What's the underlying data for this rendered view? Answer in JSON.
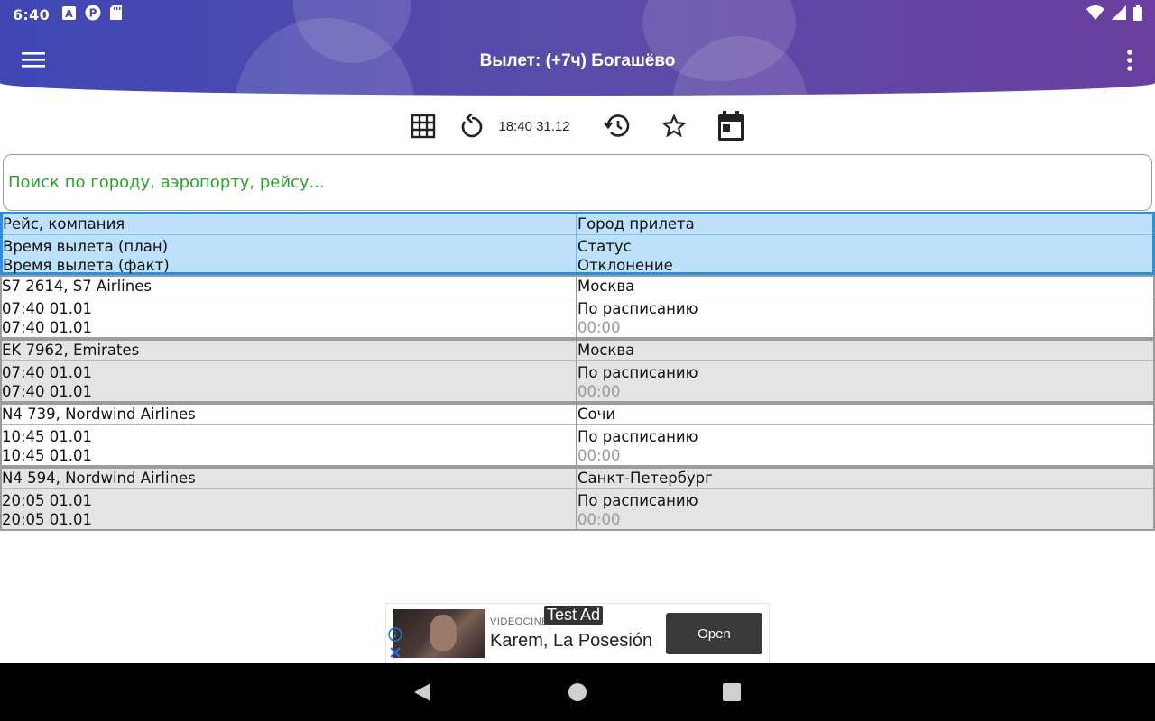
{
  "status_bar": {
    "time": "6:40",
    "left_icons": [
      "a-box-icon",
      "p-circle-icon",
      "sd-card-icon"
    ],
    "right_icons": [
      "wifi-icon",
      "signal-icon",
      "battery-icon"
    ]
  },
  "app_bar": {
    "title": "Вылет: (+7ч) Богашёво",
    "colors": {
      "gradient_start": "#3f47b5",
      "gradient_end": "#6a3fa0"
    }
  },
  "toolbar": {
    "icons": [
      "grid-icon",
      "refresh-icon",
      "history-icon",
      "star-icon",
      "calendar-icon"
    ],
    "update_time": "18:40 31.12"
  },
  "search": {
    "placeholder": "Поиск по городу, аэропорту, рейсу..."
  },
  "table": {
    "header": {
      "left": [
        "Рейс, компания",
        "Время вылета (план)",
        "Время вылета (факт)"
      ],
      "right": [
        "Город прилета",
        "Статус",
        "Отклонение"
      ]
    },
    "rows": [
      {
        "flight": "S7 2614, S7 Airlines",
        "planned": "07:40 01.01",
        "actual": "07:40 01.01",
        "city": "Москва",
        "status": "По расписанию",
        "deviation": "00:00"
      },
      {
        "flight": "EK 7962, Emirates",
        "planned": "07:40 01.01",
        "actual": "07:40 01.01",
        "city": "Москва",
        "status": "По расписанию",
        "deviation": "00:00"
      },
      {
        "flight": "N4 739, Nordwind Airlines",
        "planned": "10:45 01.01",
        "actual": "10:45 01.01",
        "city": "Сочи",
        "status": "По расписанию",
        "deviation": "00:00"
      },
      {
        "flight": "N4 594, Nordwind Airlines",
        "planned": "20:05 01.01",
        "actual": "20:05 01.01",
        "city": "Санкт-Петербург",
        "status": "По расписанию",
        "deviation": "00:00"
      }
    ],
    "colors": {
      "header_bg": "#bde0fb",
      "header_border": "#2d8de0",
      "alt_row_bg": "#e4e4e4"
    }
  },
  "ad": {
    "badge": "Test Ad",
    "source": "VIDEOCINE",
    "title": "Karem, La Posesión",
    "button_label": "Open"
  },
  "nav_bar": {
    "icons": [
      "back-icon",
      "home-icon",
      "recents-icon"
    ]
  }
}
